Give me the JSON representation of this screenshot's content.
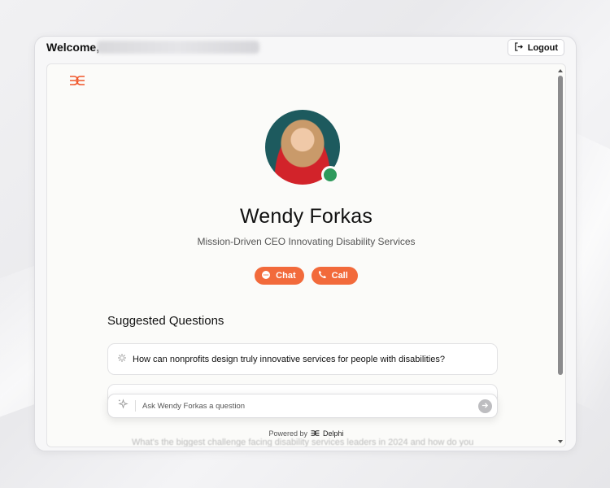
{
  "header": {
    "welcome_label": "Welcome,",
    "logout_label": "Logout"
  },
  "profile": {
    "name": "Wendy Forkas",
    "tagline": "Mission-Driven CEO Innovating Disability Services",
    "status": "online"
  },
  "actions": {
    "chat_label": "Chat",
    "call_label": "Call"
  },
  "suggested": {
    "title": "Suggested Questions",
    "questions": [
      "How can nonprofits design truly innovative services for people with disabilities?",
      "What's the biggest challenge facing disability services leaders in 2024 and how do you"
    ]
  },
  "ask": {
    "placeholder": "Ask Wendy Forkas a question"
  },
  "footer": {
    "powered_by": "Powered by",
    "brand": "Delphi"
  },
  "colors": {
    "accent": "#f26a3b",
    "status_online": "#2e9a5c"
  },
  "icons": [
    "logout-icon",
    "delphi-logo-icon",
    "chat-bubble-icon",
    "phone-icon",
    "sparkle-icon",
    "send-arrow-icon"
  ]
}
